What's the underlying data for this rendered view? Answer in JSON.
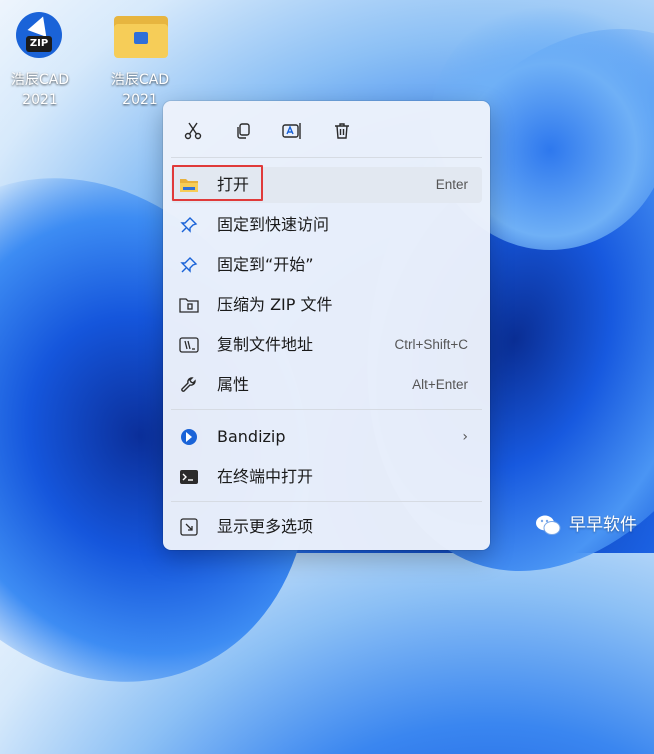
{
  "desktop": {
    "icons": [
      {
        "label_line1": "浩辰CAD",
        "label_line2": "2021",
        "icon": "zip-archive-icon"
      },
      {
        "label_line1": "浩辰CAD",
        "label_line2": "2021",
        "icon": "folder-zip-icon"
      }
    ]
  },
  "context_menu": {
    "toolbar": [
      {
        "name": "cut",
        "icon": "scissors-icon"
      },
      {
        "name": "copy",
        "icon": "copy-icon"
      },
      {
        "name": "rename",
        "icon": "rename-icon"
      },
      {
        "name": "delete",
        "icon": "trash-icon"
      }
    ],
    "items": [
      {
        "label": "打开",
        "shortcut": "Enter",
        "icon": "folder-icon",
        "highlighted": true
      },
      {
        "label": "固定到快速访问",
        "shortcut": "",
        "icon": "pin-icon"
      },
      {
        "label": "固定到“开始”",
        "shortcut": "",
        "icon": "pin-icon"
      },
      {
        "label": "压缩为 ZIP 文件",
        "shortcut": "",
        "icon": "zip-folder-icon"
      },
      {
        "label": "复制文件地址",
        "shortcut": "Ctrl+Shift+C",
        "icon": "copy-path-icon"
      },
      {
        "label": "属性",
        "shortcut": "Alt+Enter",
        "icon": "wrench-icon"
      },
      {
        "label": "Bandizip",
        "shortcut": "",
        "icon": "bandizip-icon",
        "submenu": true
      },
      {
        "label": "在终端中打开",
        "shortcut": "",
        "icon": "terminal-icon"
      },
      {
        "label": "显示更多选项",
        "shortcut": "",
        "icon": "more-options-icon"
      }
    ],
    "submenu_arrow": "›"
  },
  "watermark": {
    "text": "早早软件",
    "icon": "wechat-icon"
  },
  "colors": {
    "highlight_border": "#e03a3a",
    "accent": "#1a63d8"
  }
}
